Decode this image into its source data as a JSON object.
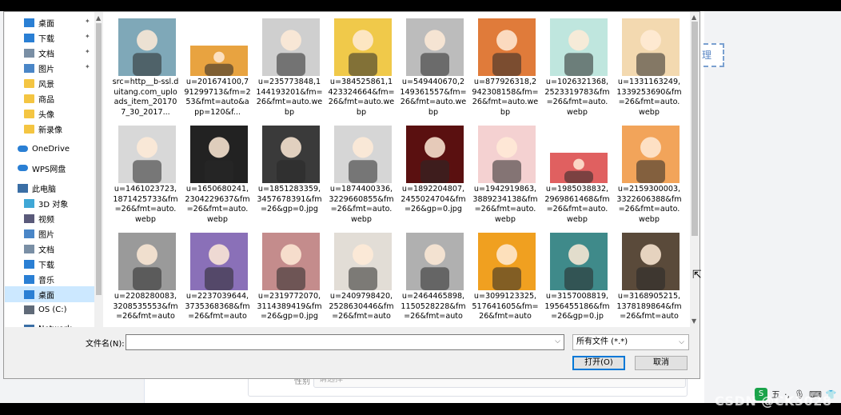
{
  "background": {
    "edit_button_label": "理",
    "form_label": "性别",
    "form_input": "请选择"
  },
  "nav": {
    "items": [
      {
        "label": "桌面",
        "icon": "desktop-icon",
        "pinned": true
      },
      {
        "label": "下载",
        "icon": "download-icon",
        "pinned": true
      },
      {
        "label": "文档",
        "icon": "document-icon",
        "pinned": true
      },
      {
        "label": "图片",
        "icon": "picture-icon",
        "pinned": true
      },
      {
        "label": "风景",
        "icon": "folder-icon",
        "pinned": false
      },
      {
        "label": "商品",
        "icon": "folder-icon",
        "pinned": false
      },
      {
        "label": "头像",
        "icon": "folder-icon",
        "pinned": false
      },
      {
        "label": "新录像",
        "icon": "folder-icon",
        "pinned": false
      },
      {
        "label": "OneDrive",
        "icon": "cloud-icon",
        "pinned": false
      },
      {
        "label": "WPS网盘",
        "icon": "wps-cloud-icon",
        "pinned": false
      },
      {
        "label": "此电脑",
        "icon": "computer-icon",
        "pinned": false
      },
      {
        "label": "3D 对象",
        "icon": "cube-icon",
        "pinned": false
      },
      {
        "label": "视频",
        "icon": "video-icon",
        "pinned": false
      },
      {
        "label": "图片",
        "icon": "picture-icon",
        "pinned": false
      },
      {
        "label": "文档",
        "icon": "document-icon",
        "pinned": false
      },
      {
        "label": "下载",
        "icon": "download-icon",
        "pinned": false
      },
      {
        "label": "音乐",
        "icon": "music-icon",
        "pinned": false
      },
      {
        "label": "桌面",
        "icon": "desktop-icon",
        "pinned": false,
        "selected": true
      },
      {
        "label": "OS (C:)",
        "icon": "drive-icon",
        "pinned": false
      },
      {
        "label": "Network",
        "icon": "network-icon",
        "pinned": false
      }
    ]
  },
  "files": [
    {
      "name": "src=http__b-ssl.duitang.com_uploads_item_201707_30_2017...",
      "icon": "girl-avatar-icon",
      "color": "#7fa8b8"
    },
    {
      "name": "u=201674100,791299713&fm=253&fmt=auto&app=120&f...",
      "icon": "car-cartoon-icon",
      "color": "#e8a340"
    },
    {
      "name": "u=235773848,1144193201&fm=26&fmt=auto.webp",
      "icon": "businessman-icon",
      "color": "#cfcfcf"
    },
    {
      "name": "u=384525861,1423324664&fm=26&fmt=auto.webp",
      "icon": "doctor-cartoon-icon",
      "color": "#f0c94a"
    },
    {
      "name": "u=549440670,2149361557&fm=26&fmt=auto.webp",
      "icon": "man-suit-icon",
      "color": "#bcbcbc"
    },
    {
      "name": "u=877926318,2942308158&fm=26&fmt=auto.webp",
      "icon": "yoga-sunset-icon",
      "color": "#e07b3a"
    },
    {
      "name": "u=1026321368,2523319783&fm=26&fmt=auto.webp",
      "icon": "girl-cartoon-icon",
      "color": "#bfe6de"
    },
    {
      "name": "u=1331163249,1339253690&fm=26&fmt=auto.webp",
      "icon": "boy-cartoon-icon",
      "color": "#f3d9b0"
    },
    {
      "name": "u=1461023723,1871425733&fm=26&fmt=auto.webp",
      "icon": "sketch-boy-icon",
      "color": "#d8d8d8"
    },
    {
      "name": "u=1650680241,2304229637&fm=26&fmt=auto.webp",
      "icon": "anime-boy-icon",
      "color": "#222222"
    },
    {
      "name": "u=1851283359,3457678391&fm=26&gp=0.jpg",
      "icon": "bw-man-icon",
      "color": "#3a3a3a"
    },
    {
      "name": "u=1874400336,3229660855&fm=26&fmt=auto.webp",
      "icon": "woman-suit-icon",
      "color": "#d6d6d6"
    },
    {
      "name": "u=1892204807,2455024704&fm=26&gp=0.jpg",
      "icon": "dark-man-icon",
      "color": "#5a1010"
    },
    {
      "name": "u=1942919863,3889234138&fm=26&fmt=auto.webp",
      "icon": "nurse-cartoon-icon",
      "color": "#f4d1d1"
    },
    {
      "name": "u=1985038832,2969861468&fm=26&fmt=auto.webp",
      "icon": "dog-car-icon",
      "color": "#e06060"
    },
    {
      "name": "u=2159300003,3322606388&fm=26&fmt=auto.webp",
      "icon": "doctor-boy-icon",
      "color": "#f2a45a"
    },
    {
      "name": "u=2208280083,3208535553&fm=26&fmt=auto",
      "icon": "woman-blazer-icon",
      "color": "#9a9a9a"
    },
    {
      "name": "u=2237039644,3735368368&fm=26&fmt=auto",
      "icon": "purple-hair-girl-icon",
      "color": "#8a70b8"
    },
    {
      "name": "u=2319772070,3114389419&fm=26&gp=0.jpg",
      "icon": "pink-girl-icon",
      "color": "#c48c8c"
    },
    {
      "name": "u=2409798420,2528630446&fm=26&fmt=auto",
      "icon": "white-shirt-woman-icon",
      "color": "#e2ddd6"
    },
    {
      "name": "u=2464465898,1150528228&fm=26&fmt=auto",
      "icon": "muscle-cartoon-icon",
      "color": "#b0b0b0"
    },
    {
      "name": "u=3099123325,517641605&fm=26&fmt=auto",
      "icon": "yellow-car-icon",
      "color": "#f0a020"
    },
    {
      "name": "u=3157008819,1956455186&fm=26&gp=0.jp",
      "icon": "beret-girl-icon",
      "color": "#3f8a8a"
    },
    {
      "name": "u=3168905215,1378189864&fm=26&fmt=auto",
      "icon": "anime-hero-icon",
      "color": "#5a4a3a"
    }
  ],
  "footer": {
    "filename_label": "文件名(N):",
    "filename_value": "",
    "filetype_selected": "所有文件 (*.*)",
    "open_label": "打开(O)",
    "cancel_label": "取消"
  },
  "tray": {
    "ime_label": "五",
    "ime_punct": "·,"
  },
  "watermark": "CSDN @CK3028"
}
